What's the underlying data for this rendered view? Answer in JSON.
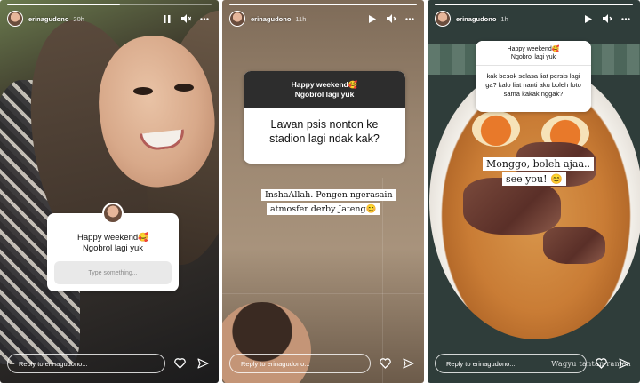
{
  "stories": [
    {
      "username": "erinagudono",
      "time": "20h",
      "progress": 0.55,
      "controls": [
        "pause-icon",
        "mute-icon",
        "more-icon"
      ],
      "sticker": {
        "prompt_line1": "Happy weekend🥰",
        "prompt_line2": "Ngobrol lagi yuk",
        "input_placeholder": "Type something..."
      },
      "reply_placeholder": "Reply to erinagudono..."
    },
    {
      "username": "erinagudono",
      "time": "11h",
      "progress": 1.0,
      "controls": [
        "play-icon",
        "mute-icon",
        "more-icon"
      ],
      "sticker": {
        "prompt_line1": "Happy weekend🥰",
        "prompt_line2": "Ngobrol lagi yuk",
        "question": "Lawan psis nonton ke stadion lagi ndak kak?"
      },
      "answer_line1": "InshaAllah. Pengen ngerasain",
      "answer_line2": "atmosfer derby Jateng😊",
      "reply_placeholder": "Reply to erinagudono..."
    },
    {
      "username": "erinagudono",
      "time": "1h",
      "progress": 1.0,
      "controls": [
        "play-icon",
        "mute-icon",
        "more-icon"
      ],
      "sticker": {
        "prompt_line1": "Happy weekend🥰",
        "prompt_line2": "Ngobrol lagi yuk",
        "question": "kak besok selasa liat persis lagi ga? kalo liat nanti aku boleh foto sama kakak nggak?"
      },
      "answer_line1": "Monggo, boleh ajaa..",
      "answer_line2": "see you! 😊",
      "watermark": "Wagyu tantan ramen",
      "reply_placeholder": "Reply to erinagudono..."
    }
  ],
  "footer_icons": [
    "heart-icon",
    "send-icon"
  ]
}
